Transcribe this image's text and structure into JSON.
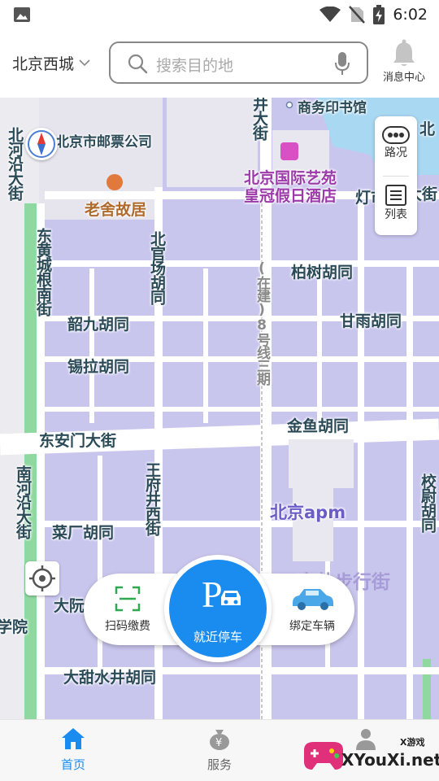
{
  "status_bar": {
    "time": "6:02",
    "icons": [
      "image-icon",
      "wifi-icon",
      "no-sim-icon",
      "battery-charging-icon"
    ]
  },
  "header": {
    "city": "北京西城",
    "search_placeholder": "搜索目的地",
    "message_center": "消息中心"
  },
  "map": {
    "side_panel": {
      "traffic": "路况",
      "list": "列表"
    },
    "labels": {
      "north_river_ave": "北河沿大街",
      "post_ticket_co": "北京市邮票公司",
      "laoshe_residence": "老舍故居",
      "jingdajie": "井大街",
      "commercial_press": "商务印书馆",
      "hotel_line1": "北京国际艺苑",
      "hotel_line2": "皇冠假日酒店",
      "bei_partial": "北",
      "dengshi_partial": "灯市",
      "jie_partial": "大街",
      "east_huangchenggen": "东黄城根南街",
      "beiguanchang": "北官场胡同",
      "metro_line": "(在建)8号线三期",
      "baishu": "柏树胡同",
      "shaojiu": "韶九胡同",
      "ganyu": "甘雨胡同",
      "xila": "锡拉胡同",
      "jinyu": "金鱼胡同",
      "dongan_gate": "东安门大街",
      "south_river_ave": "南河沿大街",
      "wangfujing_west": "王府井西街",
      "beijing_apm": "北京apm",
      "jiaowei": "校尉胡同",
      "caichang": "菜厂胡同",
      "wangfujing_walk": "王府井步行街",
      "dayuan_partial": "大阮",
      "xueyuan_partial": "学院",
      "datianshuijing": "大甜水井胡同"
    }
  },
  "actions": {
    "scan_pay": "扫码缴费",
    "park_nearby": "就近停车",
    "bind_vehicle": "绑定车辆"
  },
  "bottom_nav": {
    "home": "首页",
    "service": "服务"
  },
  "watermark": {
    "brand": "XYouXi.net",
    "tag": "X游戏"
  },
  "colors": {
    "accent": "#1a8cf0",
    "map_block": "#c9c6ee",
    "road": "#ffffff",
    "green_belt": "#8fd9a0"
  }
}
